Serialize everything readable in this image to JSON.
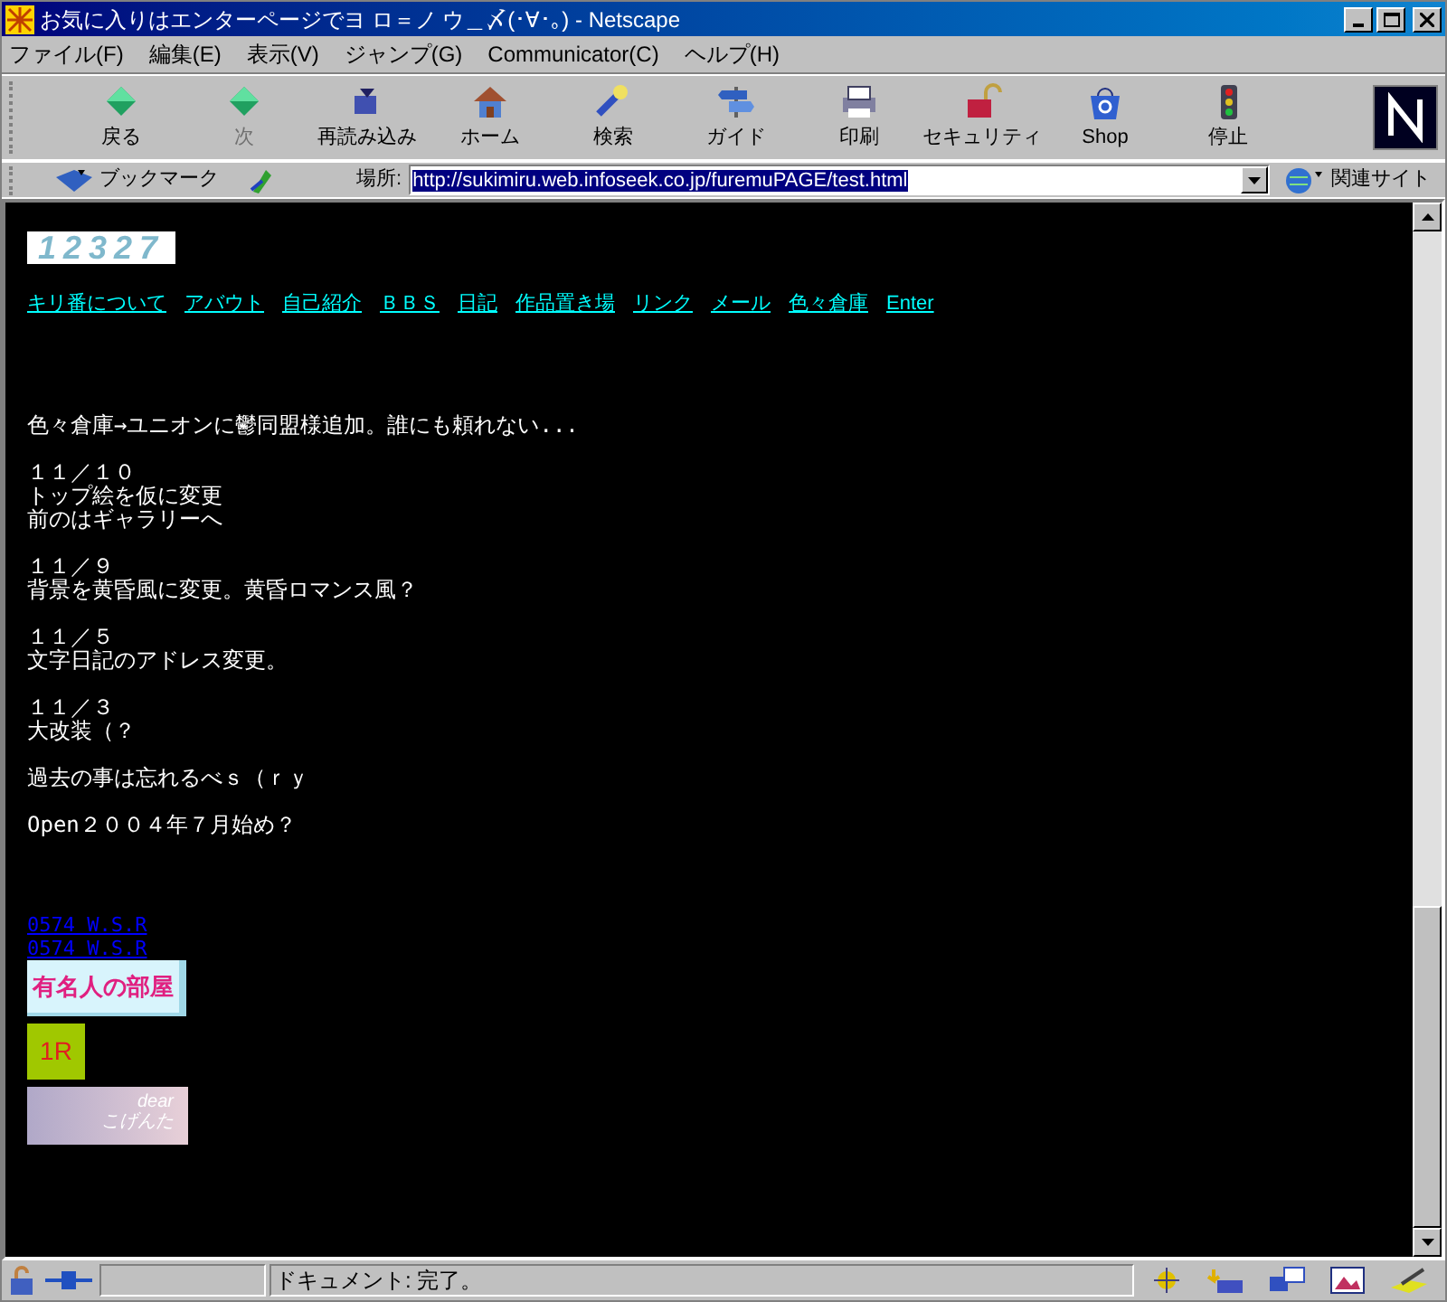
{
  "window": {
    "title": "お気に入りはエンターページでヨ ロ＝ノ ウ＿〆(･∀･｡) - Netscape"
  },
  "menu": [
    "ファイル(F)",
    "編集(E)",
    "表示(V)",
    "ジャンプ(G)",
    "Communicator(C)",
    "ヘルプ(H)"
  ],
  "toolbar": [
    {
      "label": "戻る",
      "kind": "back",
      "disabled": false
    },
    {
      "label": "次",
      "kind": "forward",
      "disabled": true
    },
    {
      "label": "再読み込み",
      "kind": "reload",
      "disabled": false
    },
    {
      "label": "ホーム",
      "kind": "home",
      "disabled": false
    },
    {
      "label": "検索",
      "kind": "search",
      "disabled": false
    },
    {
      "label": "ガイド",
      "kind": "guide",
      "disabled": false
    },
    {
      "label": "印刷",
      "kind": "print",
      "disabled": false
    },
    {
      "label": "セキュリティ",
      "kind": "security",
      "disabled": false
    },
    {
      "label": "Shop",
      "kind": "shop",
      "disabled": false
    },
    {
      "label": "停止",
      "kind": "stop",
      "disabled": false
    }
  ],
  "location_bar": {
    "bookmarks": "ブックマーク",
    "label": "場所:",
    "url": "http://sukimiru.web.infoseek.co.jp/furemuPAGE/test.html",
    "related": "関連サイト"
  },
  "page": {
    "counter": "12327",
    "nav_links": [
      "キリ番について",
      "アバウト",
      "自己紹介",
      "ＢＢＳ",
      "日記",
      "作品置き場",
      "リンク",
      "メール",
      "色々倉庫",
      "Enter"
    ],
    "news": [
      {
        "lines": [
          "色々倉庫→ユニオンに鬱同盟様追加。誰にも頼れない..."
        ]
      },
      {
        "lines": [
          "１１／１０",
          "トップ絵を仮に変更",
          "前のはギャラリーへ"
        ]
      },
      {
        "lines": [
          "１１／９",
          "背景を黄昏風に変更。黄昏ロマンス風？"
        ]
      },
      {
        "lines": [
          "１１／５",
          "文字日記のアドレス変更。"
        ]
      },
      {
        "lines": [
          "１１／３",
          "大改装（？"
        ]
      },
      {
        "lines": [
          "過去の事は忘れるべｓ（ｒｙ"
        ]
      },
      {
        "lines": [
          "Open２００４年７月始め？"
        ]
      }
    ],
    "footer_links": [
      "0574 W.S.R",
      "0574 W.S.R"
    ],
    "banners": [
      {
        "text": "有名人の部屋",
        "kind": "rainbow"
      },
      {
        "text": "1R",
        "kind": "square"
      },
      {
        "text": "dear こげんた",
        "kind": "photo"
      }
    ]
  },
  "status_bar": {
    "text": "ドキュメント: 完了。"
  }
}
